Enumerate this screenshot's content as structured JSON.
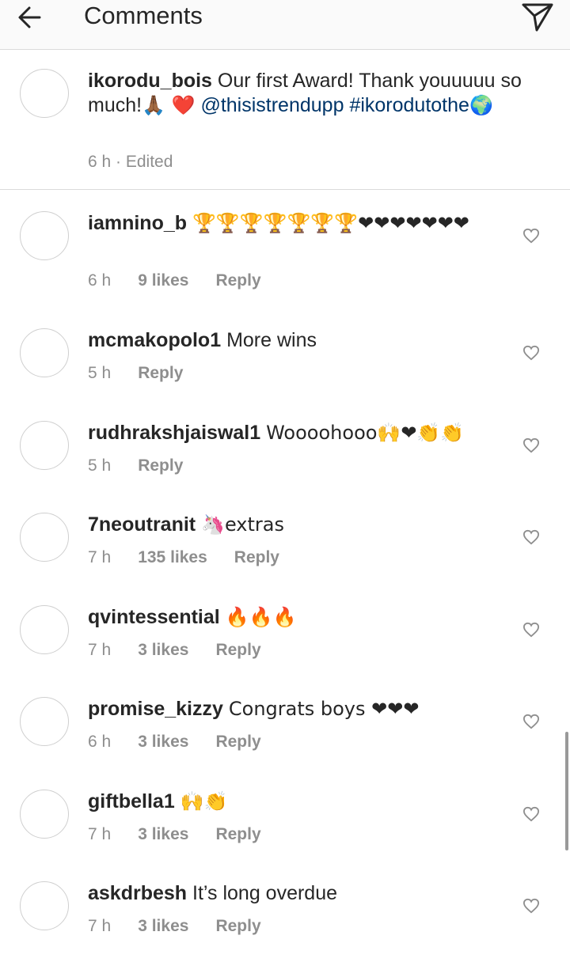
{
  "header": {
    "title": "Comments",
    "back_icon": "arrow-left-icon",
    "send_icon": "paper-plane-icon"
  },
  "caption": {
    "username": "ikorodu_bois",
    "text_part1": "Our first Award! Thank youuuuu so much!",
    "emoji1": "🙏🏾 ❤️",
    "mention": "@thisistrendupp",
    "hashtag": "#ikorodutothe",
    "emoji2": "🌍",
    "time": "6 h",
    "edited": "· Edited"
  },
  "comments": [
    {
      "username": "iamnino_b",
      "text": "🏆🏆🏆🏆🏆🏆🏆❤❤❤❤❤❤❤",
      "time": "6 h",
      "likes": "9 likes",
      "reply": "Reply"
    },
    {
      "username": "mcmakopolo1",
      "text": "More wins",
      "time": "5 h",
      "likes": "",
      "reply": "Reply"
    },
    {
      "username": "rudhrakshjaiswal1",
      "text": "Woooohooo🙌❤👏👏",
      "time": "5 h",
      "likes": "",
      "reply": "Reply"
    },
    {
      "username": "7neoutranit",
      "text": "🦄extras",
      "time": "7 h",
      "likes": "135 likes",
      "reply": "Reply"
    },
    {
      "username": "qvintessential",
      "text": "🔥🔥🔥",
      "time": "7 h",
      "likes": "3 likes",
      "reply": "Reply"
    },
    {
      "username": "promise_kizzy",
      "text": "Congrats boys ❤❤❤",
      "time": "6 h",
      "likes": "3 likes",
      "reply": "Reply"
    },
    {
      "username": "giftbella1",
      "text": "🙌👏",
      "time": "7 h",
      "likes": "3 likes",
      "reply": "Reply"
    },
    {
      "username": "askdrbesh",
      "text": "It’s long overdue",
      "time": "7 h",
      "likes": "3 likes",
      "reply": "Reply"
    }
  ],
  "icons": {
    "like": "heart-outline-icon",
    "avatar": "avatar-placeholder"
  }
}
